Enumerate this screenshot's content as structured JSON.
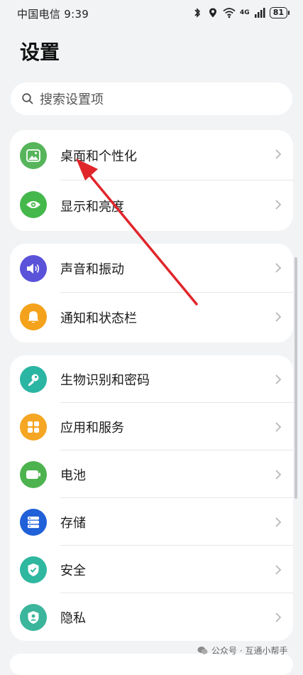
{
  "status_bar": {
    "carrier_time": "中国电信 9:39",
    "network_label": "4G",
    "battery": "81",
    "icons": [
      "bluetooth-icon",
      "location-icon",
      "wifi-icon",
      "signal-icon",
      "battery-icon"
    ]
  },
  "page": {
    "title": "设置"
  },
  "search": {
    "placeholder": "搜索设置项"
  },
  "groups": [
    {
      "items": [
        {
          "label": "桌面和个性化",
          "icon": "wallpaper-icon",
          "color": "#56b55a"
        },
        {
          "label": "显示和亮度",
          "icon": "eye-icon",
          "color": "#45b84b"
        }
      ]
    },
    {
      "items": [
        {
          "label": "声音和振动",
          "icon": "speaker-icon",
          "color": "#5a52d9"
        },
        {
          "label": "通知和状态栏",
          "icon": "bell-icon",
          "color": "#f4a21b"
        }
      ]
    },
    {
      "items": [
        {
          "label": "生物识别和密码",
          "icon": "key-icon",
          "color": "#2bb5a3"
        },
        {
          "label": "应用和服务",
          "icon": "apps-icon",
          "color": "#f5a623"
        },
        {
          "label": "电池",
          "icon": "battery-icon",
          "color": "#4db34f"
        },
        {
          "label": "存储",
          "icon": "storage-icon",
          "color": "#2060d8"
        },
        {
          "label": "安全",
          "icon": "shield-check-icon",
          "color": "#2fb7a0"
        },
        {
          "label": "隐私",
          "icon": "privacy-icon",
          "color": "#3bb59b"
        }
      ]
    }
  ],
  "watermark": {
    "text": "公众号 · 互通小帮手"
  },
  "annotation": {
    "arrow_color": "#e0262b"
  }
}
